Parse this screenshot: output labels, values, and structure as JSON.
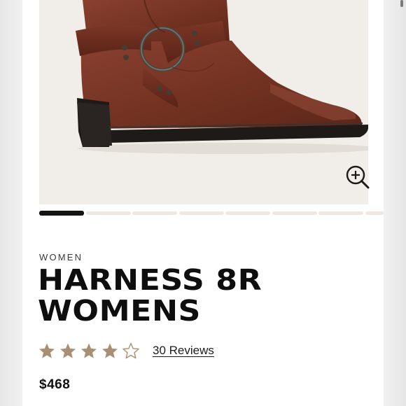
{
  "product": {
    "category": "WOMEN",
    "title": "HARNESS 8R WOMENS",
    "rating": 4,
    "rating_max": 5,
    "reviews_label": "30 Reviews",
    "price": "$468"
  },
  "gallery": {
    "image_count": 8,
    "active_index": 0
  },
  "icons": {
    "zoom": "zoom-in-icon",
    "star_filled": "star-filled-icon",
    "star_empty": "star-outline-icon"
  },
  "colors": {
    "star": "#a98f73",
    "title": "#0e0e0e",
    "active_indicator": "#141414",
    "inactive_indicator": "#efe8e1",
    "boot_leather": "#7a3524"
  }
}
